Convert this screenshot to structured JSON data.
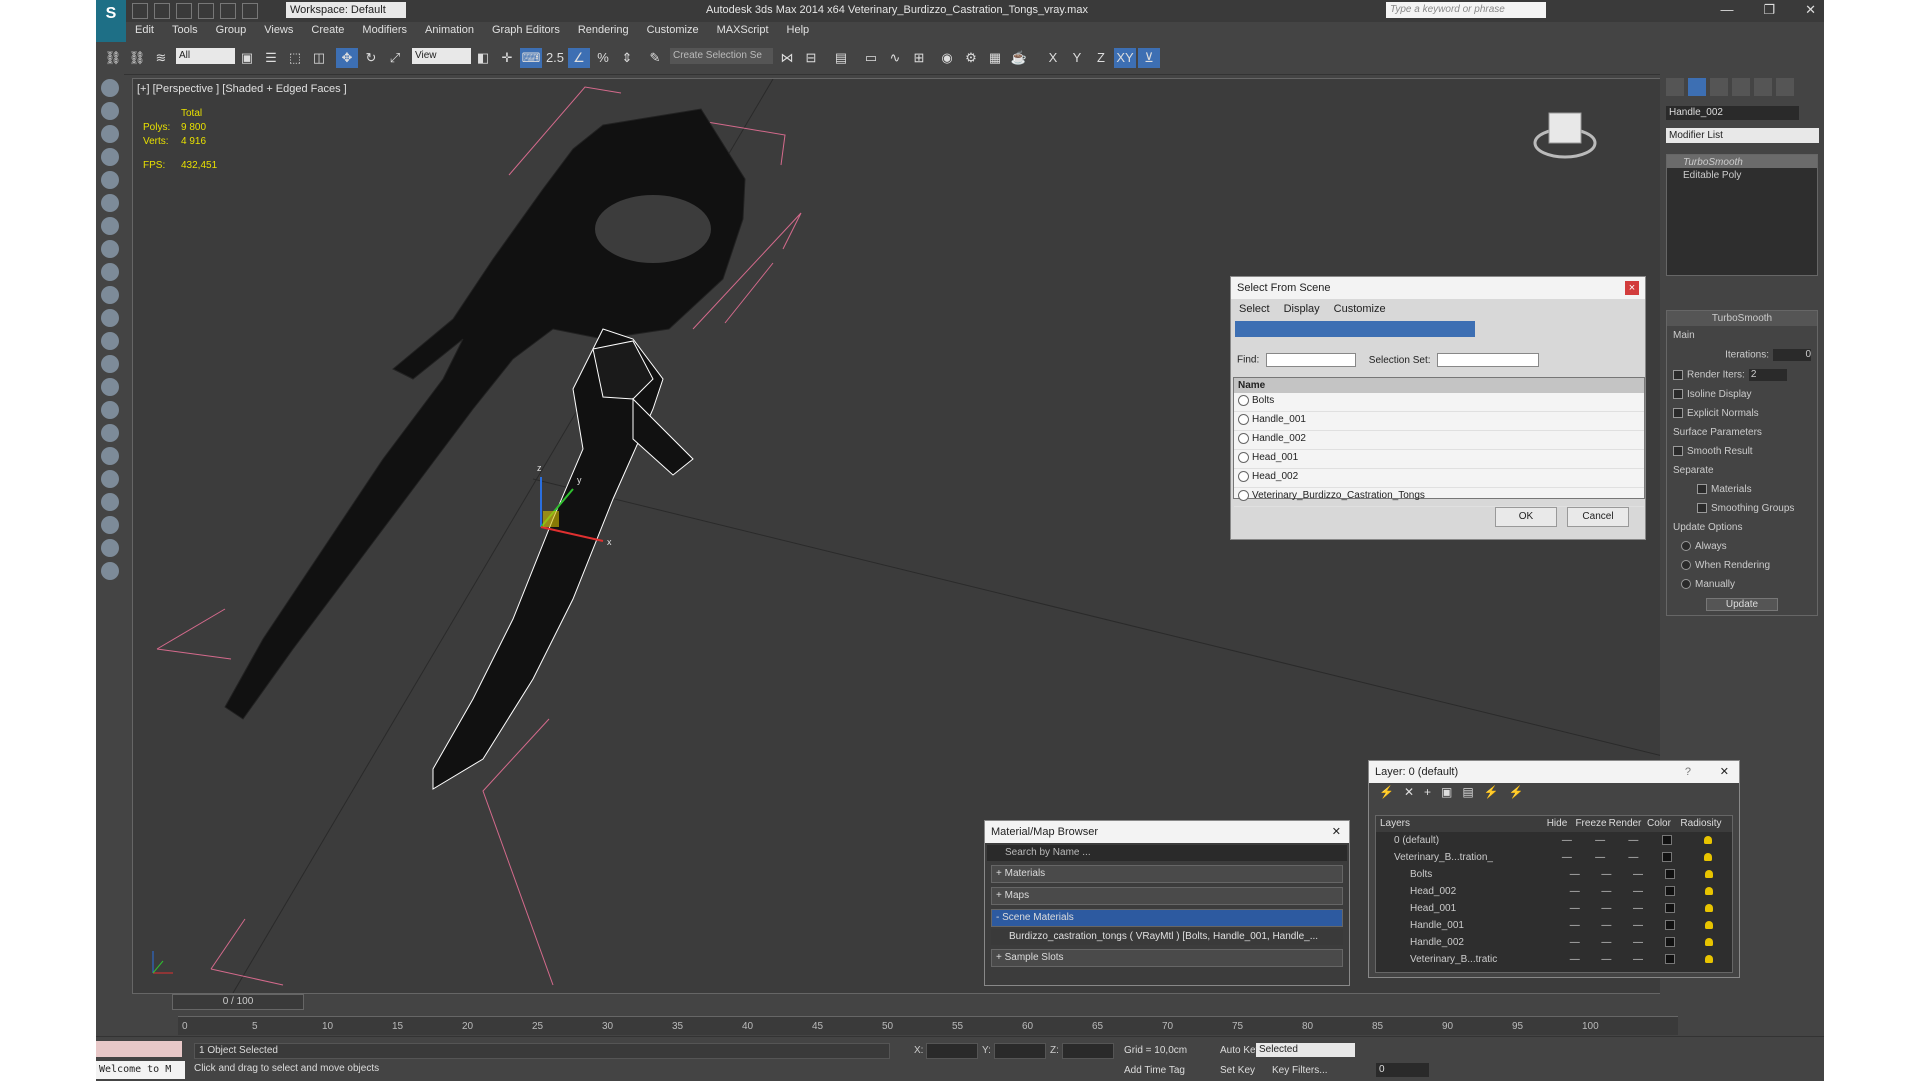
{
  "app": {
    "title": "Autodesk 3ds Max  2014 x64     Veterinary_Burdizzo_Castration_Tongs_vray.max",
    "workspace": "Workspace: Default",
    "search_placeholder": "Type a keyword or phrase",
    "logo": "S",
    "window_controls": [
      "—",
      "❐",
      "✕"
    ]
  },
  "menu": [
    "Edit",
    "Tools",
    "Group",
    "Views",
    "Create",
    "Modifiers",
    "Animation",
    "Graph Editors",
    "Rendering",
    "Customize",
    "MAXScript",
    "Help"
  ],
  "toolbar": {
    "filter": "All",
    "refcoord": "View",
    "snap_value": "2.5",
    "selection_set": "Create Selection Se",
    "axis_buttons": [
      "X",
      "Y",
      "Z",
      "XY"
    ]
  },
  "viewport": {
    "label": "[+] [Perspective ] [Shaded + Edged Faces ]",
    "stats": {
      "total_label": "Total",
      "polys_label": "Polys:",
      "polys": "9 800",
      "verts_label": "Verts:",
      "verts": "4 916",
      "fps_label": "FPS:",
      "fps": "432,451"
    },
    "gizmo_axes": [
      "x",
      "y",
      "z"
    ]
  },
  "command_panel": {
    "object_name": "Handle_002",
    "modifier_list": "Modifier List",
    "stack": [
      "TurboSmooth",
      "Editable Poly"
    ],
    "rollout_title": "TurboSmooth",
    "main_label": "Main",
    "iterations_label": "Iterations:",
    "iterations": "0",
    "render_iters_label": "Render Iters:",
    "render_iters": "2",
    "isoline": "Isoline Display",
    "explicit": "Explicit Normals",
    "surface_params": "Surface Parameters",
    "smooth_result": "Smooth Result",
    "separate": "Separate",
    "materials": "Materials",
    "smoothing_groups": "Smoothing Groups",
    "update_options": "Update Options",
    "always": "Always",
    "when_rendering": "When Rendering",
    "manually": "Manually",
    "update_btn": "Update"
  },
  "select_from_scene": {
    "title": "Select From Scene",
    "close": "×",
    "menu": [
      "Select",
      "Display",
      "Customize"
    ],
    "find_label": "Find:",
    "selection_set_label": "Selection Set:",
    "column": "Name",
    "items": [
      "Bolts",
      "Handle_001",
      "Handle_002",
      "Head_001",
      "Head_002",
      "Veterinary_Burdizzo_Castration_Tongs"
    ],
    "ok": "OK",
    "cancel": "Cancel"
  },
  "material_browser": {
    "title": "Material/Map Browser",
    "close": "✕",
    "search": "Search by Name ...",
    "sections": [
      "+ Materials",
      "+ Maps",
      "- Scene Materials"
    ],
    "material": "Burdizzo_castration_tongs  ( VRayMtl ) [Bolts, Handle_001, Handle_...",
    "sample_slots": "+ Sample Slots"
  },
  "layers": {
    "title": "Layer: 0 (default)",
    "help": "?",
    "close": "✕",
    "tool_icons": [
      "⚡",
      "✕",
      "+",
      "▣",
      "▤",
      "⚡",
      "⚡"
    ],
    "columns": [
      "Layers",
      "Hide",
      "Freeze",
      "Render",
      "Color",
      "Radiosity"
    ],
    "rows": [
      {
        "name": "0 (default)",
        "sub": false
      },
      {
        "name": "Veterinary_B...tration_",
        "sub": false
      },
      {
        "name": "Bolts",
        "sub": true
      },
      {
        "name": "Head_002",
        "sub": true
      },
      {
        "name": "Head_001",
        "sub": true
      },
      {
        "name": "Handle_001",
        "sub": true
      },
      {
        "name": "Handle_002",
        "sub": true
      },
      {
        "name": "Veterinary_B...tratic",
        "sub": true
      }
    ]
  },
  "timeline": {
    "frame": "0 / 100",
    "ticks": [
      "0",
      "5",
      "10",
      "15",
      "20",
      "25",
      "30",
      "35",
      "40",
      "45",
      "50",
      "55",
      "60",
      "65",
      "70",
      "75",
      "80",
      "85",
      "90",
      "95",
      "100"
    ]
  },
  "status": {
    "welcome": "Welcome to M",
    "selected": "1 Object Selected",
    "prompt": "Click and drag to select and move objects",
    "x_label": "X:",
    "y_label": "Y:",
    "z_label": "Z:",
    "grid": "Grid = 10,0cm",
    "add_time_tag": "Add Time Tag",
    "auto_key": "Auto Key",
    "auto_key_sel": "Selected",
    "set_key": "Set Key",
    "key_filters": "Key Filters...",
    "frame_field": "0"
  }
}
